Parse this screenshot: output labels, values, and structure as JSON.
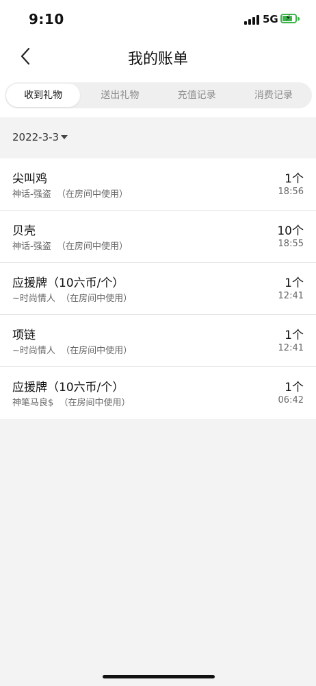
{
  "status_bar": {
    "time": "9:10",
    "network": "5G"
  },
  "header": {
    "title": "我的账单"
  },
  "tabs": [
    {
      "label": "收到礼物",
      "active": true
    },
    {
      "label": "送出礼物",
      "active": false
    },
    {
      "label": "充值记录",
      "active": false
    },
    {
      "label": "消费记录",
      "active": false
    }
  ],
  "date_filter": {
    "value": "2022-3-3"
  },
  "records": [
    {
      "name": "尖叫鸡",
      "sender": "神话-强盗",
      "note": "（在房间中使用）",
      "count": "1个",
      "time": "18:56"
    },
    {
      "name": "贝壳",
      "sender": "神话-强盗",
      "note": "（在房间中使用）",
      "count": "10个",
      "time": "18:55"
    },
    {
      "name": "应援牌（10六币/个）",
      "sender": "~时尚情人",
      "note": "（在房间中使用）",
      "count": "1个",
      "time": "12:41"
    },
    {
      "name": "项链",
      "sender": "~时尚情人",
      "note": "（在房间中使用）",
      "count": "1个",
      "time": "12:41"
    },
    {
      "name": "应援牌（10六币/个）",
      "sender": "神笔马良$",
      "note": "（在房间中使用）",
      "count": "1个",
      "time": "06:42"
    }
  ],
  "colors": {
    "battery": "#3bb54a",
    "background": "#f3f3f3"
  }
}
